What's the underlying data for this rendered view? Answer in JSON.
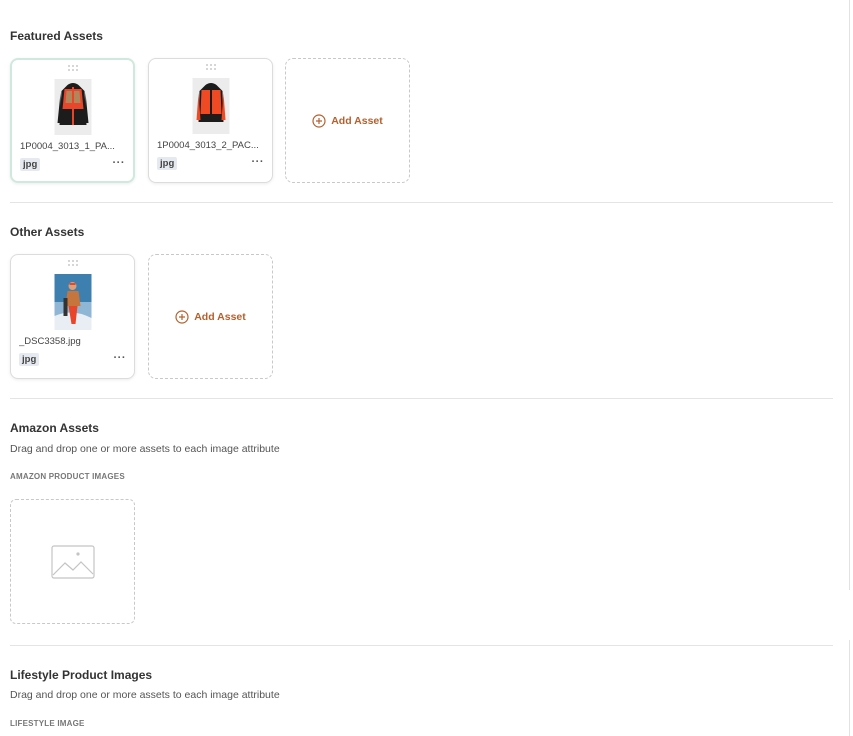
{
  "featured": {
    "title": "Featured Assets",
    "assets": [
      {
        "filename": "1P0004_3013_1_PA...",
        "ext": "jpg",
        "more": "···"
      },
      {
        "filename": "1P0004_3013_2_PAC...",
        "ext": "jpg",
        "more": "···"
      }
    ],
    "add_label": "Add Asset"
  },
  "other": {
    "title": "Other Assets",
    "assets": [
      {
        "filename": "_DSC3358.jpg",
        "ext": "jpg",
        "more": "···"
      }
    ],
    "add_label": "Add Asset"
  },
  "amazon": {
    "title": "Amazon Assets",
    "hint": "Drag and drop one or more assets to each image attribute",
    "subhead": "AMAZON PRODUCT IMAGES"
  },
  "lifestyle": {
    "title": "Lifestyle Product Images",
    "hint": "Drag and drop one or more assets to each image attribute",
    "subhead": "LIFESTYLE IMAGE"
  },
  "colors": {
    "accent": "#b5602e",
    "selected_border": "#cfe9df",
    "jacket_orange": "#e8452a"
  }
}
